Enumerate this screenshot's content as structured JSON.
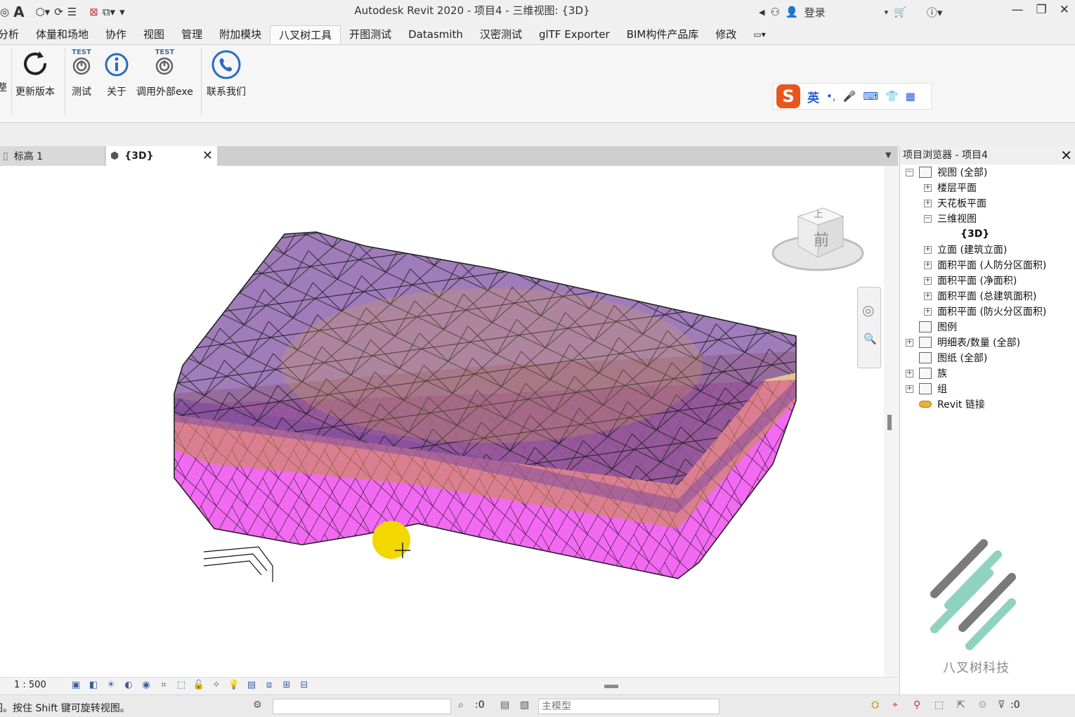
{
  "app": {
    "title": "Autodesk Revit 2020 - 项目4 - 三维视图: {3D}",
    "login_label": "登录",
    "qat_font_glyph": "A"
  },
  "menu": {
    "tabs": [
      "分析",
      "体量和场地",
      "协作",
      "视图",
      "管理",
      "附加模块",
      "八叉树工具",
      "开图测试",
      "Datasmith",
      "汉密测试",
      "glTF Exporter",
      "BIM构件产品库",
      "修改"
    ],
    "active_index": 6
  },
  "ribbon": {
    "left_cut_label": "整",
    "buttons": [
      {
        "label": "更新版本",
        "icon": "refresh-icon"
      },
      {
        "label": "测试",
        "icon": "test-power-icon",
        "badge": "TEST"
      },
      {
        "label": "关于",
        "icon": "info-icon"
      },
      {
        "label": "调用外部exe",
        "icon": "test-power-icon",
        "badge": "TEST"
      },
      {
        "label": "联系我们",
        "icon": "phone-icon"
      }
    ]
  },
  "ime": {
    "logo": "S",
    "language": "英",
    "icons": [
      "punctuation-icon",
      "microphone-icon",
      "keyboard-icon",
      "skin-icon",
      "apps-icon"
    ]
  },
  "view_tabs": [
    {
      "label": "标高 1",
      "active": false
    },
    {
      "label": "{3D}",
      "active": true
    }
  ],
  "viewcube": {
    "face_front": "前",
    "face_top": "上"
  },
  "view_controls": {
    "scale": "1 : 500"
  },
  "status_bar": {
    "message": "图。按住 Shift 键可旋转视图。",
    "workset_value": "",
    "selection_count": ":0",
    "model_placeholder": "主模型",
    "filter_count": ":0"
  },
  "project_browser": {
    "title": "项目浏览器 - 项目4",
    "items": [
      {
        "label": "视图 (全部)",
        "level": 0,
        "expander": "−",
        "icon": "views-icon"
      },
      {
        "label": "楼层平面",
        "level": 1,
        "expander": "+"
      },
      {
        "label": "天花板平面",
        "level": 1,
        "expander": "+"
      },
      {
        "label": "三维视图",
        "level": 1,
        "expander": "−"
      },
      {
        "label": "{3D}",
        "level": 2,
        "expander": "",
        "bold": true
      },
      {
        "label": "立面 (建筑立面)",
        "level": 1,
        "expander": "+"
      },
      {
        "label": "面积平面 (人防分区面积)",
        "level": 1,
        "expander": "+"
      },
      {
        "label": "面积平面 (净面积)",
        "level": 1,
        "expander": "+"
      },
      {
        "label": "面积平面 (总建筑面积)",
        "level": 1,
        "expander": "+"
      },
      {
        "label": "面积平面 (防火分区面积)",
        "level": 1,
        "expander": "+"
      },
      {
        "label": "图例",
        "level": 0,
        "expander": "",
        "icon": "legend-icon"
      },
      {
        "label": "明细表/数量 (全部)",
        "level": 0,
        "expander": "+",
        "icon": "schedule-icon"
      },
      {
        "label": "图纸 (全部)",
        "level": 0,
        "expander": "",
        "icon": "sheet-icon"
      },
      {
        "label": "族",
        "level": 0,
        "expander": "+",
        "icon": "family-icon"
      },
      {
        "label": "组",
        "level": 0,
        "expander": "+",
        "icon": "group-icon"
      },
      {
        "label": "Revit 链接",
        "level": 0,
        "expander": "",
        "icon": "link-icon"
      }
    ]
  },
  "watermark": {
    "text": "八叉树科技"
  },
  "colors": {
    "terrain_top": "#7b4aa0",
    "terrain_side": "#f050f0",
    "terrain_mid": "#c89040",
    "cursor_highlight": "#f2d800",
    "logo_gray": "#7a7a7a",
    "logo_teal": "#8fd3bf"
  }
}
